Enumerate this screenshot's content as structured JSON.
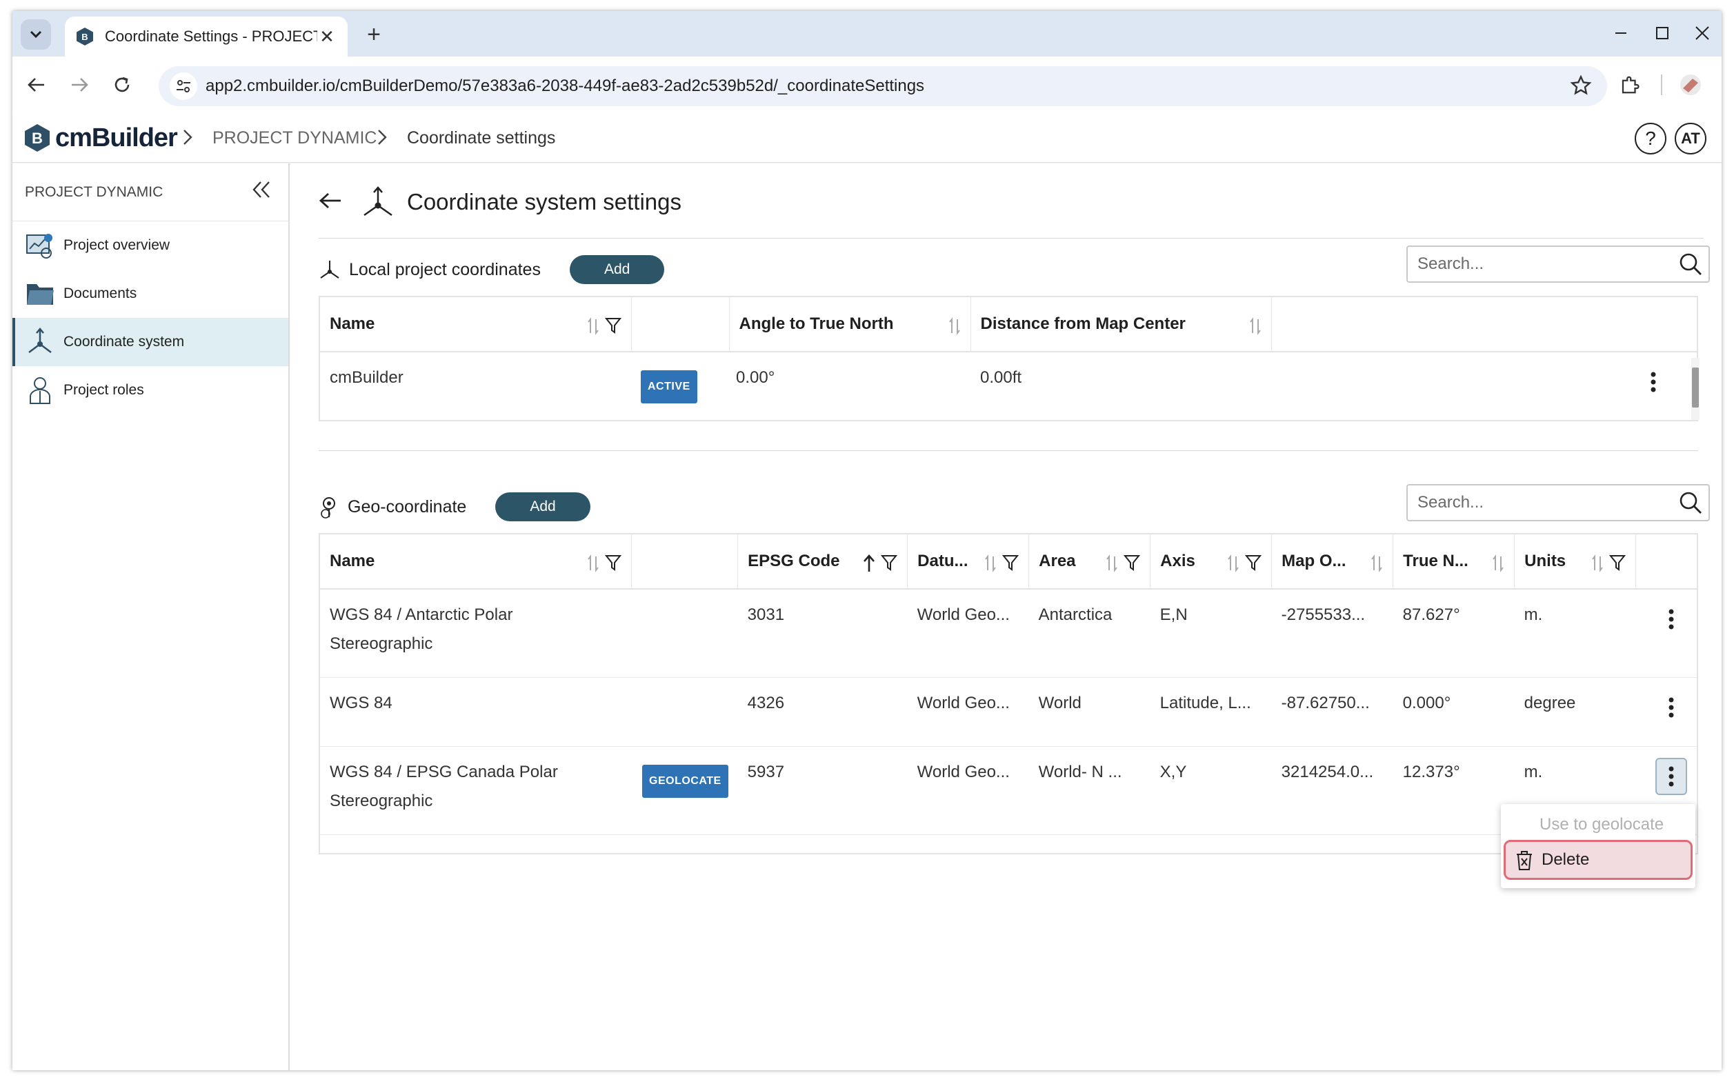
{
  "browser": {
    "tab_title": "Coordinate Settings - PROJECT",
    "url": "app2.cmbuilder.io/cmBuilderDemo/57e383a6-2038-449f-ae83-2ad2c539b52d/_coordinateSettings"
  },
  "app": {
    "logo_text": "cmBuilder",
    "breadcrumb": [
      "PROJECT DYNAMIC",
      "Coordinate settings"
    ],
    "avatar_initials": "AT",
    "help_label": "?"
  },
  "sidebar": {
    "title": "PROJECT DYNAMIC",
    "items": [
      {
        "label": "Project overview",
        "icon": "project-overview-icon",
        "active": false
      },
      {
        "label": "Documents",
        "icon": "folder-icon",
        "active": false
      },
      {
        "label": "Coordinate system",
        "icon": "coordinate-axes-icon",
        "active": true
      },
      {
        "label": "Project roles",
        "icon": "person-role-icon",
        "active": false
      }
    ]
  },
  "page": {
    "title": "Coordinate system settings"
  },
  "local": {
    "label": "Local project coordinates",
    "add_label": "Add",
    "search_placeholder": "Search...",
    "columns": [
      "Name",
      "Angle to True North",
      "Distance from Map Center"
    ],
    "rows": [
      {
        "name": "cmBuilder",
        "badge": "ACTIVE",
        "angle": "0.00°",
        "distance": "0.00ft"
      }
    ]
  },
  "geo": {
    "label": "Geo-coordinate",
    "add_label": "Add",
    "search_placeholder": "Search...",
    "columns": [
      "Name",
      "EPSG Code",
      "Datu...",
      "Area",
      "Axis",
      "Map O...",
      "True N...",
      "Units"
    ],
    "rows": [
      {
        "name_line1": "WGS 84 / Antarctic Polar",
        "name_line2": "Stereographic",
        "badge": "",
        "epsg": "3031",
        "datum": "World Geo...",
        "area": "Antarctica",
        "axis": "E,N",
        "map_origin": "-2755533...",
        "true_north": "87.627°",
        "units": "m."
      },
      {
        "name_line1": "WGS 84",
        "name_line2": "",
        "badge": "",
        "epsg": "4326",
        "datum": "World Geo...",
        "area": "World",
        "axis": "Latitude, L...",
        "map_origin": "-87.62750...",
        "true_north": "0.000°",
        "units": "degree"
      },
      {
        "name_line1": "WGS 84 / EPSG Canada Polar",
        "name_line2": "Stereographic",
        "badge": "GEOLOCATE",
        "epsg": "5937",
        "datum": "World Geo...",
        "area": "World- N ...",
        "axis": "X,Y",
        "map_origin": "3214254.0...",
        "true_north": "12.373°",
        "units": "m."
      }
    ]
  },
  "context_menu": {
    "items": [
      {
        "label": "Use to geolocate",
        "disabled": true
      },
      {
        "label": "Delete",
        "disabled": false
      }
    ]
  },
  "colors": {
    "accent": "#2c5668",
    "badge": "#2e73b6",
    "active_nav": "#dfeef3",
    "delete_highlight": "#e06b78"
  }
}
